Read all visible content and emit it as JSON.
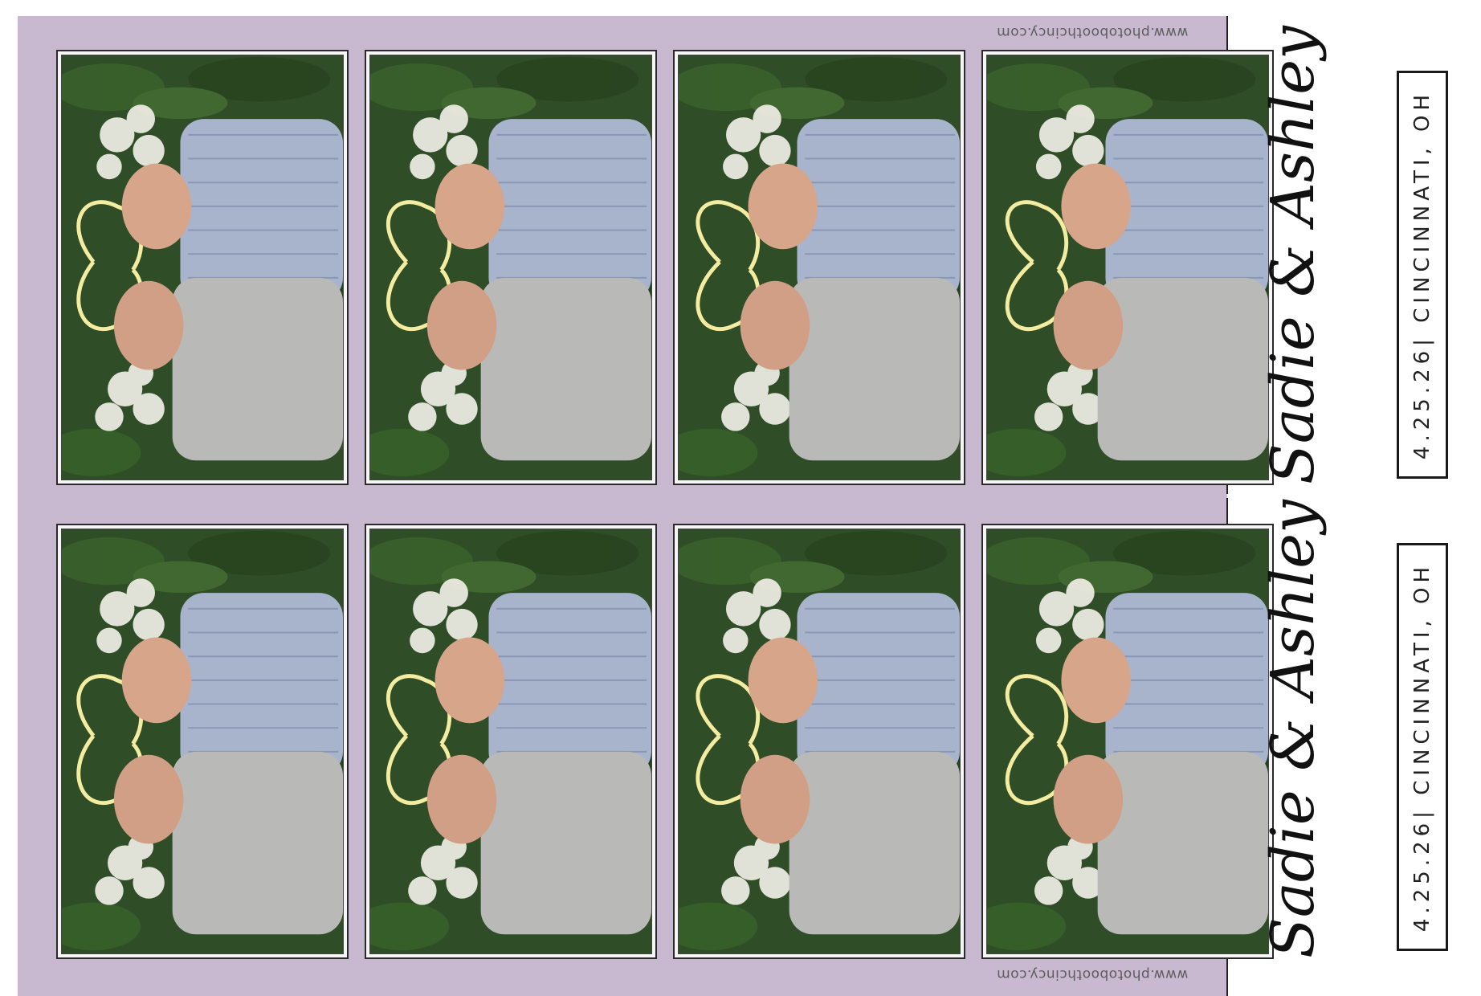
{
  "strips": [
    {
      "website": "www.photoboothcincy.com",
      "names": "Sadie & Ashley",
      "date_location": "4.25.26| CINCINNATI, OH",
      "photos": 4
    },
    {
      "website": "www.photoboothcincy.com",
      "names": "Sadie & Ashley",
      "date_location": "4.25.26| CINCINNATI, OH",
      "photos": 4
    }
  ],
  "colors": {
    "panel": "#c8b9d1",
    "foliage": "#2f4d26",
    "neon": "#fff6a8"
  }
}
